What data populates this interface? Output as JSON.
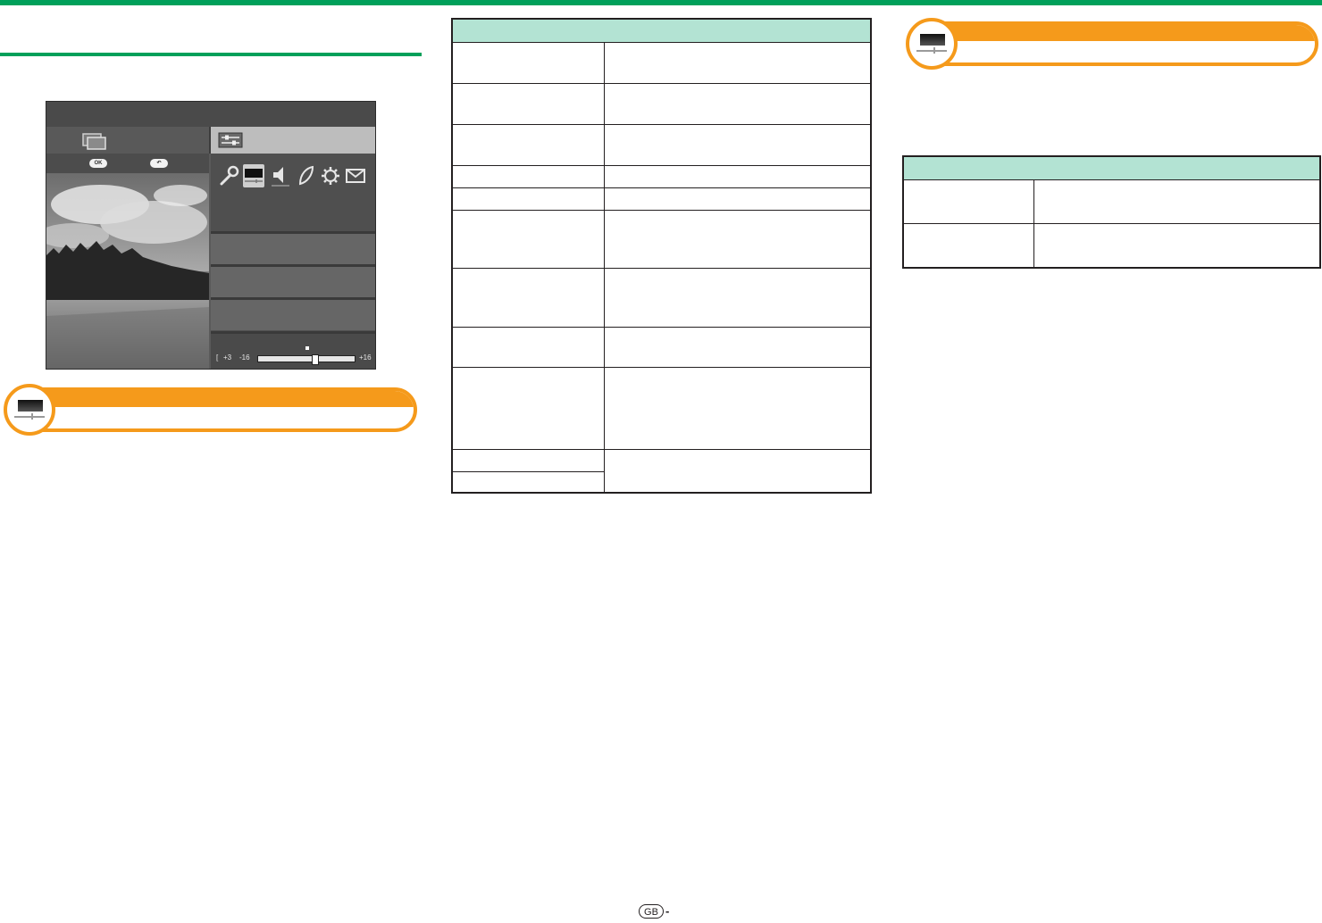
{
  "tv_menu": {
    "ok_label": "OK",
    "back_label": "↶",
    "slider": {
      "current": "+3",
      "min": "-16",
      "max": "+16",
      "value": 3,
      "range": [
        -16,
        16
      ]
    }
  },
  "footer": {
    "region_code": "GB",
    "separator": "-"
  },
  "colors": {
    "accent_green": "#00a05a",
    "banner_orange": "#f59a1b",
    "table_header": "#b3e3d3"
  },
  "icons": [
    "wrench-icon",
    "picture-icon",
    "speaker-icon",
    "leaf-icon",
    "gear-icon",
    "envelope-icon"
  ]
}
